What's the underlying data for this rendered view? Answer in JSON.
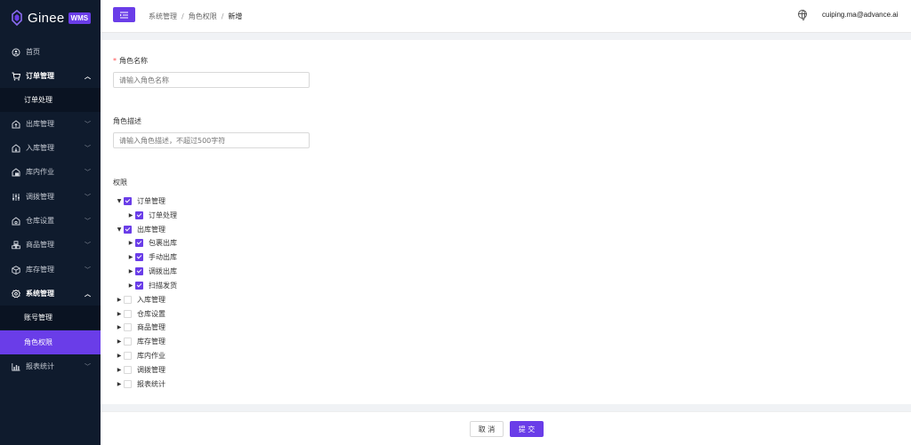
{
  "brand": {
    "name": "Ginee",
    "badge": "WMS"
  },
  "sidebar": {
    "items": [
      {
        "label": "首页",
        "icon": "home-icon"
      },
      {
        "label": "订单管理",
        "icon": "cart-icon",
        "expanded": true,
        "children": [
          {
            "label": "订单处理"
          }
        ]
      },
      {
        "label": "出库管理",
        "icon": "outbound-icon"
      },
      {
        "label": "入库管理",
        "icon": "inbound-icon"
      },
      {
        "label": "库内作业",
        "icon": "warehouse-work-icon"
      },
      {
        "label": "调拨管理",
        "icon": "transfer-icon"
      },
      {
        "label": "仓库设置",
        "icon": "warehouse-settings-icon"
      },
      {
        "label": "商品管理",
        "icon": "product-icon"
      },
      {
        "label": "库存管理",
        "icon": "inventory-icon"
      },
      {
        "label": "系统管理",
        "icon": "gear-icon",
        "expanded": true,
        "children": [
          {
            "label": "账号管理"
          },
          {
            "label": "角色权限",
            "active": true
          }
        ]
      },
      {
        "label": "报表统计",
        "icon": "bar-chart-icon"
      }
    ]
  },
  "header": {
    "breadcrumb": [
      "系统管理",
      "角色权限",
      "新增"
    ],
    "user": "cuiping.ma@advance.ai"
  },
  "form": {
    "role_name": {
      "label": "角色名称",
      "required": true,
      "placeholder": "请输入角色名称",
      "value": ""
    },
    "role_desc": {
      "label": "角色描述",
      "placeholder": "请输入角色描述，不超过500字符",
      "value": ""
    },
    "permissions_label": "权限",
    "tree": [
      {
        "label": "订单管理",
        "checked": true,
        "expanded": true,
        "children": [
          {
            "label": "订单处理",
            "checked": true
          }
        ]
      },
      {
        "label": "出库管理",
        "checked": true,
        "expanded": true,
        "children": [
          {
            "label": "包裹出库",
            "checked": true
          },
          {
            "label": "手动出库",
            "checked": true
          },
          {
            "label": "调拨出库",
            "checked": true
          },
          {
            "label": "扫描发货",
            "checked": true
          }
        ]
      },
      {
        "label": "入库管理",
        "checked": false
      },
      {
        "label": "仓库设置",
        "checked": false
      },
      {
        "label": "商品管理",
        "checked": false
      },
      {
        "label": "库存管理",
        "checked": false
      },
      {
        "label": "库内作业",
        "checked": false
      },
      {
        "label": "调拨管理",
        "checked": false
      },
      {
        "label": "报表统计",
        "checked": false
      }
    ]
  },
  "footer": {
    "cancel_label": "取 消",
    "submit_label": "提 交"
  },
  "colors": {
    "accent": "#6a3de8",
    "sidebar_bg": "#0f1b2d",
    "required": "#ff4d4f"
  }
}
